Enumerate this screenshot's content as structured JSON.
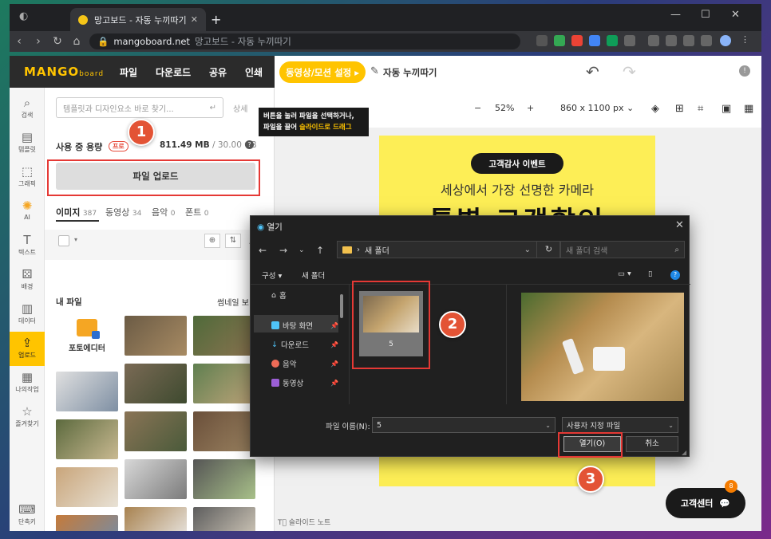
{
  "browser": {
    "tab_title": "망고보드 - 자동 누끼따기",
    "url_domain": "mangoboard.net",
    "url_title": "망고보드 - 자동 누끼따기"
  },
  "app": {
    "logo": "MANGO",
    "logo_sub": "board",
    "menu": [
      "파일",
      "다운로드",
      "공유",
      "인쇄"
    ],
    "motion_button": "동영상/모션 설정 ▸",
    "doc_title": "자동 누끼따기"
  },
  "rail": [
    {
      "icon": "magnifier",
      "glyph": "⌕",
      "label": "검색"
    },
    {
      "icon": "template",
      "glyph": "▤",
      "label": "템플릿"
    },
    {
      "icon": "graphic",
      "glyph": "⬚",
      "label": "그래픽"
    },
    {
      "icon": "ai",
      "glyph": "✺",
      "label": "AI"
    },
    {
      "icon": "text",
      "glyph": "T",
      "label": "텍스트"
    },
    {
      "icon": "background",
      "glyph": "⚄",
      "label": "배경"
    },
    {
      "icon": "data",
      "glyph": "▥",
      "label": "데이터"
    },
    {
      "icon": "upload",
      "glyph": "⇪",
      "label": "업로드"
    },
    {
      "icon": "mywork",
      "glyph": "▦",
      "label": "나의작업"
    },
    {
      "icon": "star",
      "glyph": "☆",
      "label": "즐겨찾기"
    },
    {
      "icon": "keyboard",
      "glyph": "⌨",
      "label": "단축키"
    }
  ],
  "panel": {
    "search_placeholder": "템플릿과 디자인요소 바로 찾기...",
    "detail": "상세",
    "usage_label": "사용 중 용량",
    "pro_badge": "프로",
    "usage_used": "811.49 MB",
    "usage_total": "/ 30.00 GB",
    "upload_button": "파일 업로드",
    "tabs": [
      {
        "label": "이미지",
        "count": "387"
      },
      {
        "label": "동영상",
        "count": "34"
      },
      {
        "label": "음악",
        "count": "0"
      },
      {
        "label": "폰트",
        "count": "0"
      }
    ],
    "my_files": "내 파일",
    "thumb_mode": "썸네일 보",
    "photo_editor": "포토에디터"
  },
  "tooltip": {
    "line1": "버튼을 눌러 파일을 선택하거나,",
    "line2a": "파일을 끌어 ",
    "line2b": "슬라이드로 드래그"
  },
  "stage": {
    "zoom": "52%",
    "size": "860 x 1100 px",
    "event_badge": "고객감사 이벤트",
    "headline": "세상에서 가장 선명한 카메라",
    "big_title": "특별 고객할인",
    "slide_note": "슬라이드 노트",
    "help_button": "고객센터",
    "help_count": "8"
  },
  "dialog": {
    "title": "열기",
    "path_folder": "새 폴더",
    "search_placeholder": "새 폴더 검색",
    "cmd_organize": "구성 ▾",
    "cmd_new_folder": "새 폴더",
    "side_items": [
      {
        "label": "홈",
        "pin": ""
      },
      {
        "label": "바탕 화면",
        "pin": "📌"
      },
      {
        "label": "다운로드",
        "pin": "📌"
      },
      {
        "label": "음악",
        "pin": "📌"
      },
      {
        "label": "동영상",
        "pin": "📌"
      }
    ],
    "file_name": "5",
    "filename_label": "파일 이름(N):",
    "filename_value": "5",
    "filetype_value": "사용자 지정 파일",
    "open_button": "열기(O)",
    "cancel_button": "취소"
  },
  "annotations": {
    "step1": "1",
    "step2": "2",
    "step3": "3"
  },
  "colors": {
    "brand": "#ffc400",
    "annotation": "#e53935",
    "badge_orange": "#e35335"
  }
}
